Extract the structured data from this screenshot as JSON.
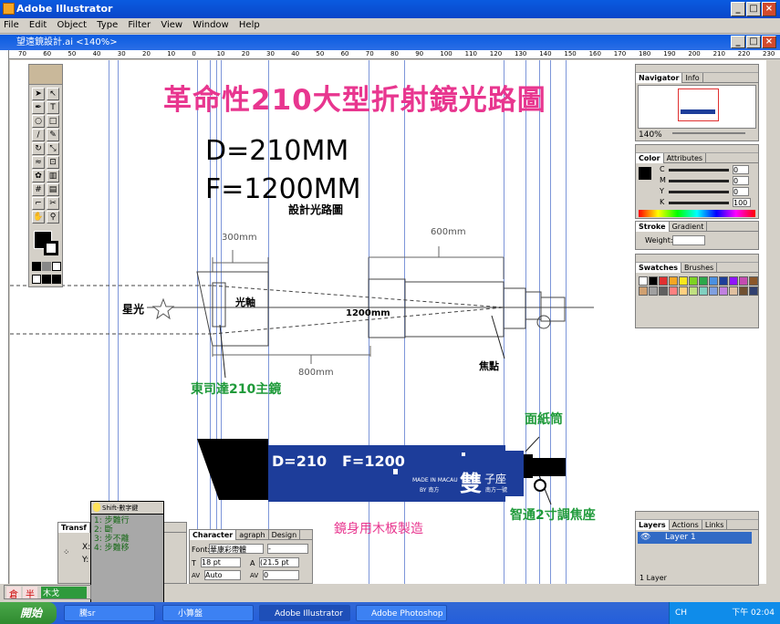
{
  "app": {
    "title": "Adobe Illustrator",
    "menu": [
      "File",
      "Edit",
      "Object",
      "Type",
      "Filter",
      "View",
      "Window",
      "Help"
    ],
    "document_title": "望遠鏡設計.ai <140%>"
  },
  "ruler_marks": [
    "70",
    "60",
    "50",
    "40",
    "30",
    "20",
    "10",
    "0",
    "10",
    "20",
    "30",
    "40",
    "50",
    "60",
    "70",
    "80",
    "90",
    "100",
    "110",
    "120",
    "130",
    "140",
    "150",
    "160",
    "170",
    "180",
    "190",
    "200",
    "210",
    "220",
    "230"
  ],
  "artwork": {
    "headline": "革命性210大型折射鏡光路圖",
    "spec_d": "D=210MM",
    "spec_f": "F=1200MM",
    "design_label": "設計光路圖",
    "dim_300": "300mm",
    "dim_600": "600mm",
    "dim_800": "800mm",
    "dim_1200": "1200mm",
    "star_label": "星光",
    "axis_label": "光軸",
    "focus_label": "焦點",
    "main_lens_label": "東司達210主鏡",
    "tissue_tube_label": "面紙筒",
    "focuser_label": "智通2寸調焦座",
    "body_note": "鏡身用木板製造",
    "tube_text_d": "D=210",
    "tube_text_f": "F=1200",
    "tube_made_in": "MADE IN MACAU",
    "tube_by": "BY 南方",
    "tube_brand_big": "雙",
    "tube_brand_small": "子座",
    "tube_brand_sub": "南方一號"
  },
  "navigator": {
    "tabs": [
      "Navigator",
      "Info"
    ],
    "zoom": "140%"
  },
  "color_panel": {
    "tabs": [
      "Color",
      "Attributes"
    ],
    "channels": [
      {
        "label": "C",
        "value": "0",
        "unit": "%"
      },
      {
        "label": "M",
        "value": "0",
        "unit": "%"
      },
      {
        "label": "Y",
        "value": "0",
        "unit": "%"
      },
      {
        "label": "K",
        "value": "100",
        "unit": "%"
      }
    ]
  },
  "stroke_panel": {
    "tabs": [
      "Stroke",
      "Gradient"
    ],
    "weight_label": "Weight:"
  },
  "swatches_panel": {
    "tabs": [
      "Swatches",
      "Brushes"
    ]
  },
  "layers_panel": {
    "tabs": [
      "Layers",
      "Actions",
      "Links"
    ],
    "layer_name": "Layer 1",
    "footer": "1 Layer"
  },
  "transform_panel": {
    "title": "Transf",
    "x_label": "X:",
    "y_label": "Y:"
  },
  "character_panel": {
    "tabs": [
      "Character",
      "agraph",
      "Design"
    ],
    "font_label": "Font:",
    "font_value": "華康彩帶體",
    "style_value": "-",
    "size_value": "18 pt",
    "leading_value": "(21.5 pt",
    "kerning_value": "Auto",
    "tracking_value": "0"
  },
  "ime_popup": {
    "header": "Shift-數字鍵",
    "items": [
      "1: 步難行",
      "2: 斷",
      "3: 步不離",
      "4: 步難移"
    ]
  },
  "ime_bar": {
    "mode1": "倉",
    "mode2": "半",
    "mode3": "木戈"
  },
  "taskbar": {
    "start": "開始",
    "items": [
      "騰sr",
      "小算盤",
      "Adobe Illustrator",
      "Adobe Photoshop"
    ],
    "tray_lang": "CH",
    "clock": "下午 02:04"
  },
  "colors": {
    "headline": "#e8368f",
    "green_label": "#1f9a3a",
    "tube_blue": "#1d3d9a",
    "guide": "#5c7ccf",
    "titlebar": "#0a5be0"
  }
}
